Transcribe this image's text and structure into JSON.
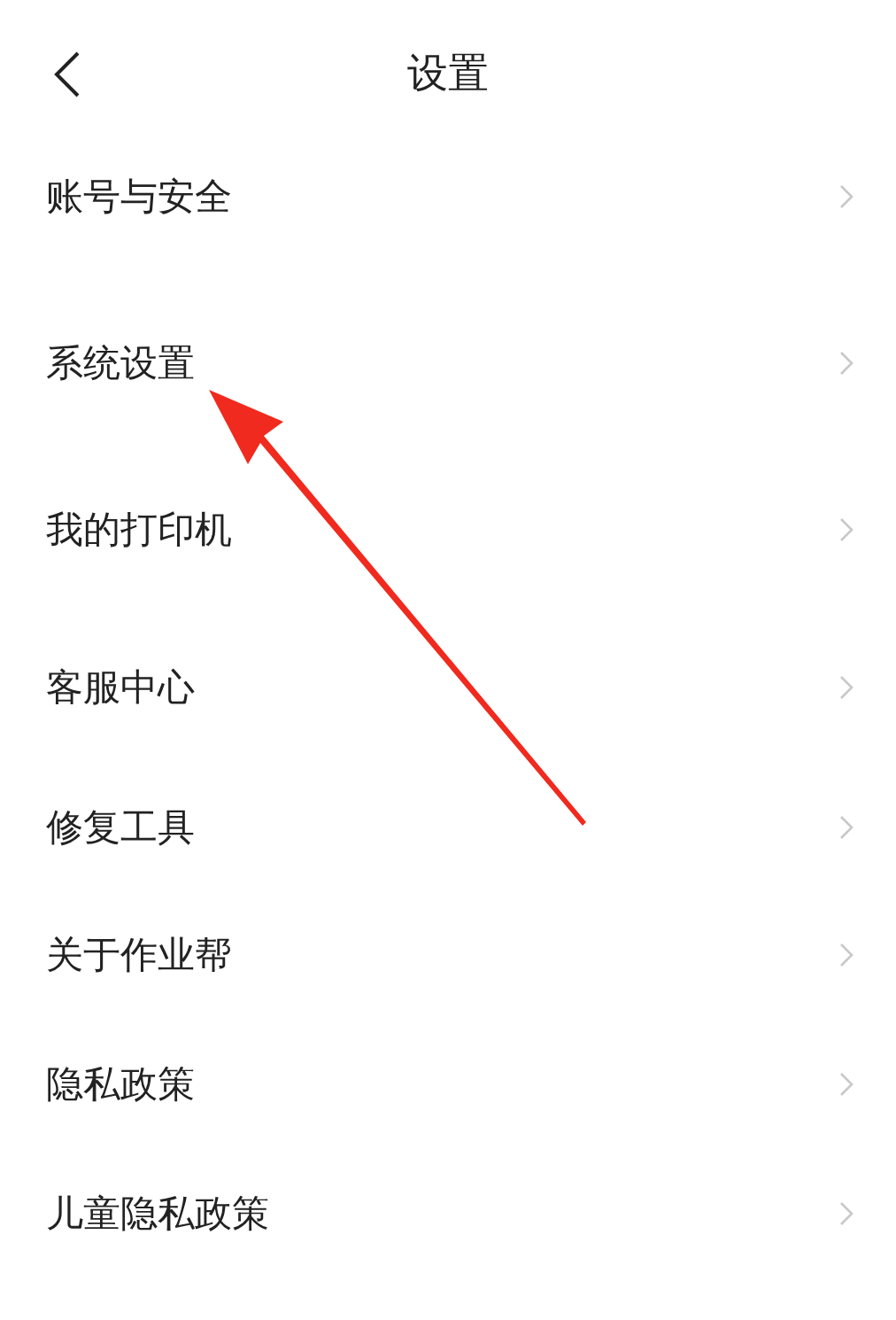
{
  "header": {
    "title": "设置"
  },
  "items": [
    {
      "label": "账号与安全"
    },
    {
      "label": "系统设置"
    },
    {
      "label": "我的打印机"
    },
    {
      "label": "客服中心"
    },
    {
      "label": "修复工具"
    },
    {
      "label": "关于作业帮"
    },
    {
      "label": "隐私政策"
    },
    {
      "label": "儿童隐私政策"
    }
  ]
}
